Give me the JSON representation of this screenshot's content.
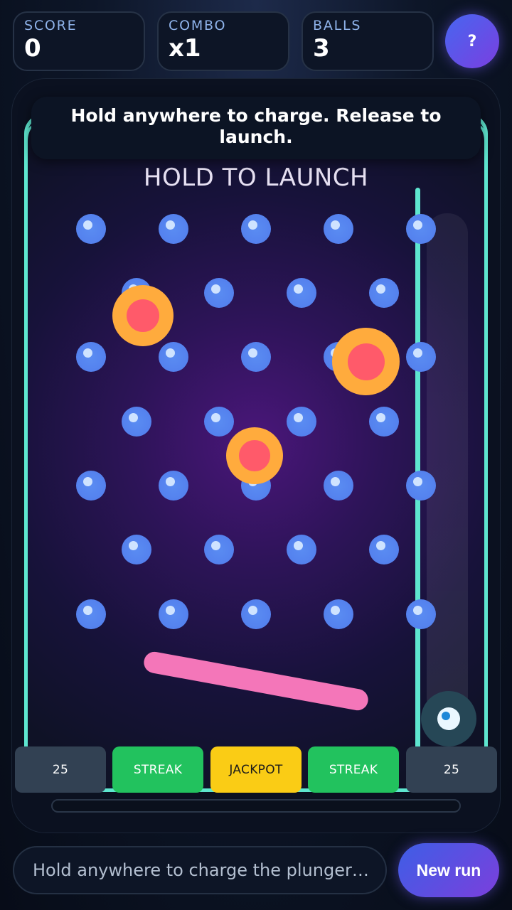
{
  "hud": {
    "score_label": "SCORE",
    "score_value": "0",
    "combo_label": "COMBO",
    "combo_value": "x1",
    "balls_label": "BALLS",
    "balls_value": "3",
    "help_label": "?"
  },
  "board": {
    "tooltip": "Hold anywhere to charge. Release to launch.",
    "launch_prompt": "HOLD TO LAUNCH",
    "power_level": 0
  },
  "slots": [
    {
      "label": "25",
      "style": "grey"
    },
    {
      "label": "STREAK",
      "style": "green"
    },
    {
      "label": "JACKPOT",
      "style": "gold"
    },
    {
      "label": "STREAK",
      "style": "green"
    },
    {
      "label": "25",
      "style": "grey"
    }
  ],
  "footer": {
    "status_text": "Hold anywhere to charge the plunger…",
    "new_run_label": "New run"
  },
  "colors": {
    "wall": "#5ee6cf",
    "peg": "#5481ee",
    "bumper_ring": "#ffab3d",
    "bumper_core": "#ff5a6a",
    "flipper": "#f476b9",
    "slot_green": "#22c25e",
    "slot_gold": "#facc15",
    "slot_grey": "#324153"
  }
}
